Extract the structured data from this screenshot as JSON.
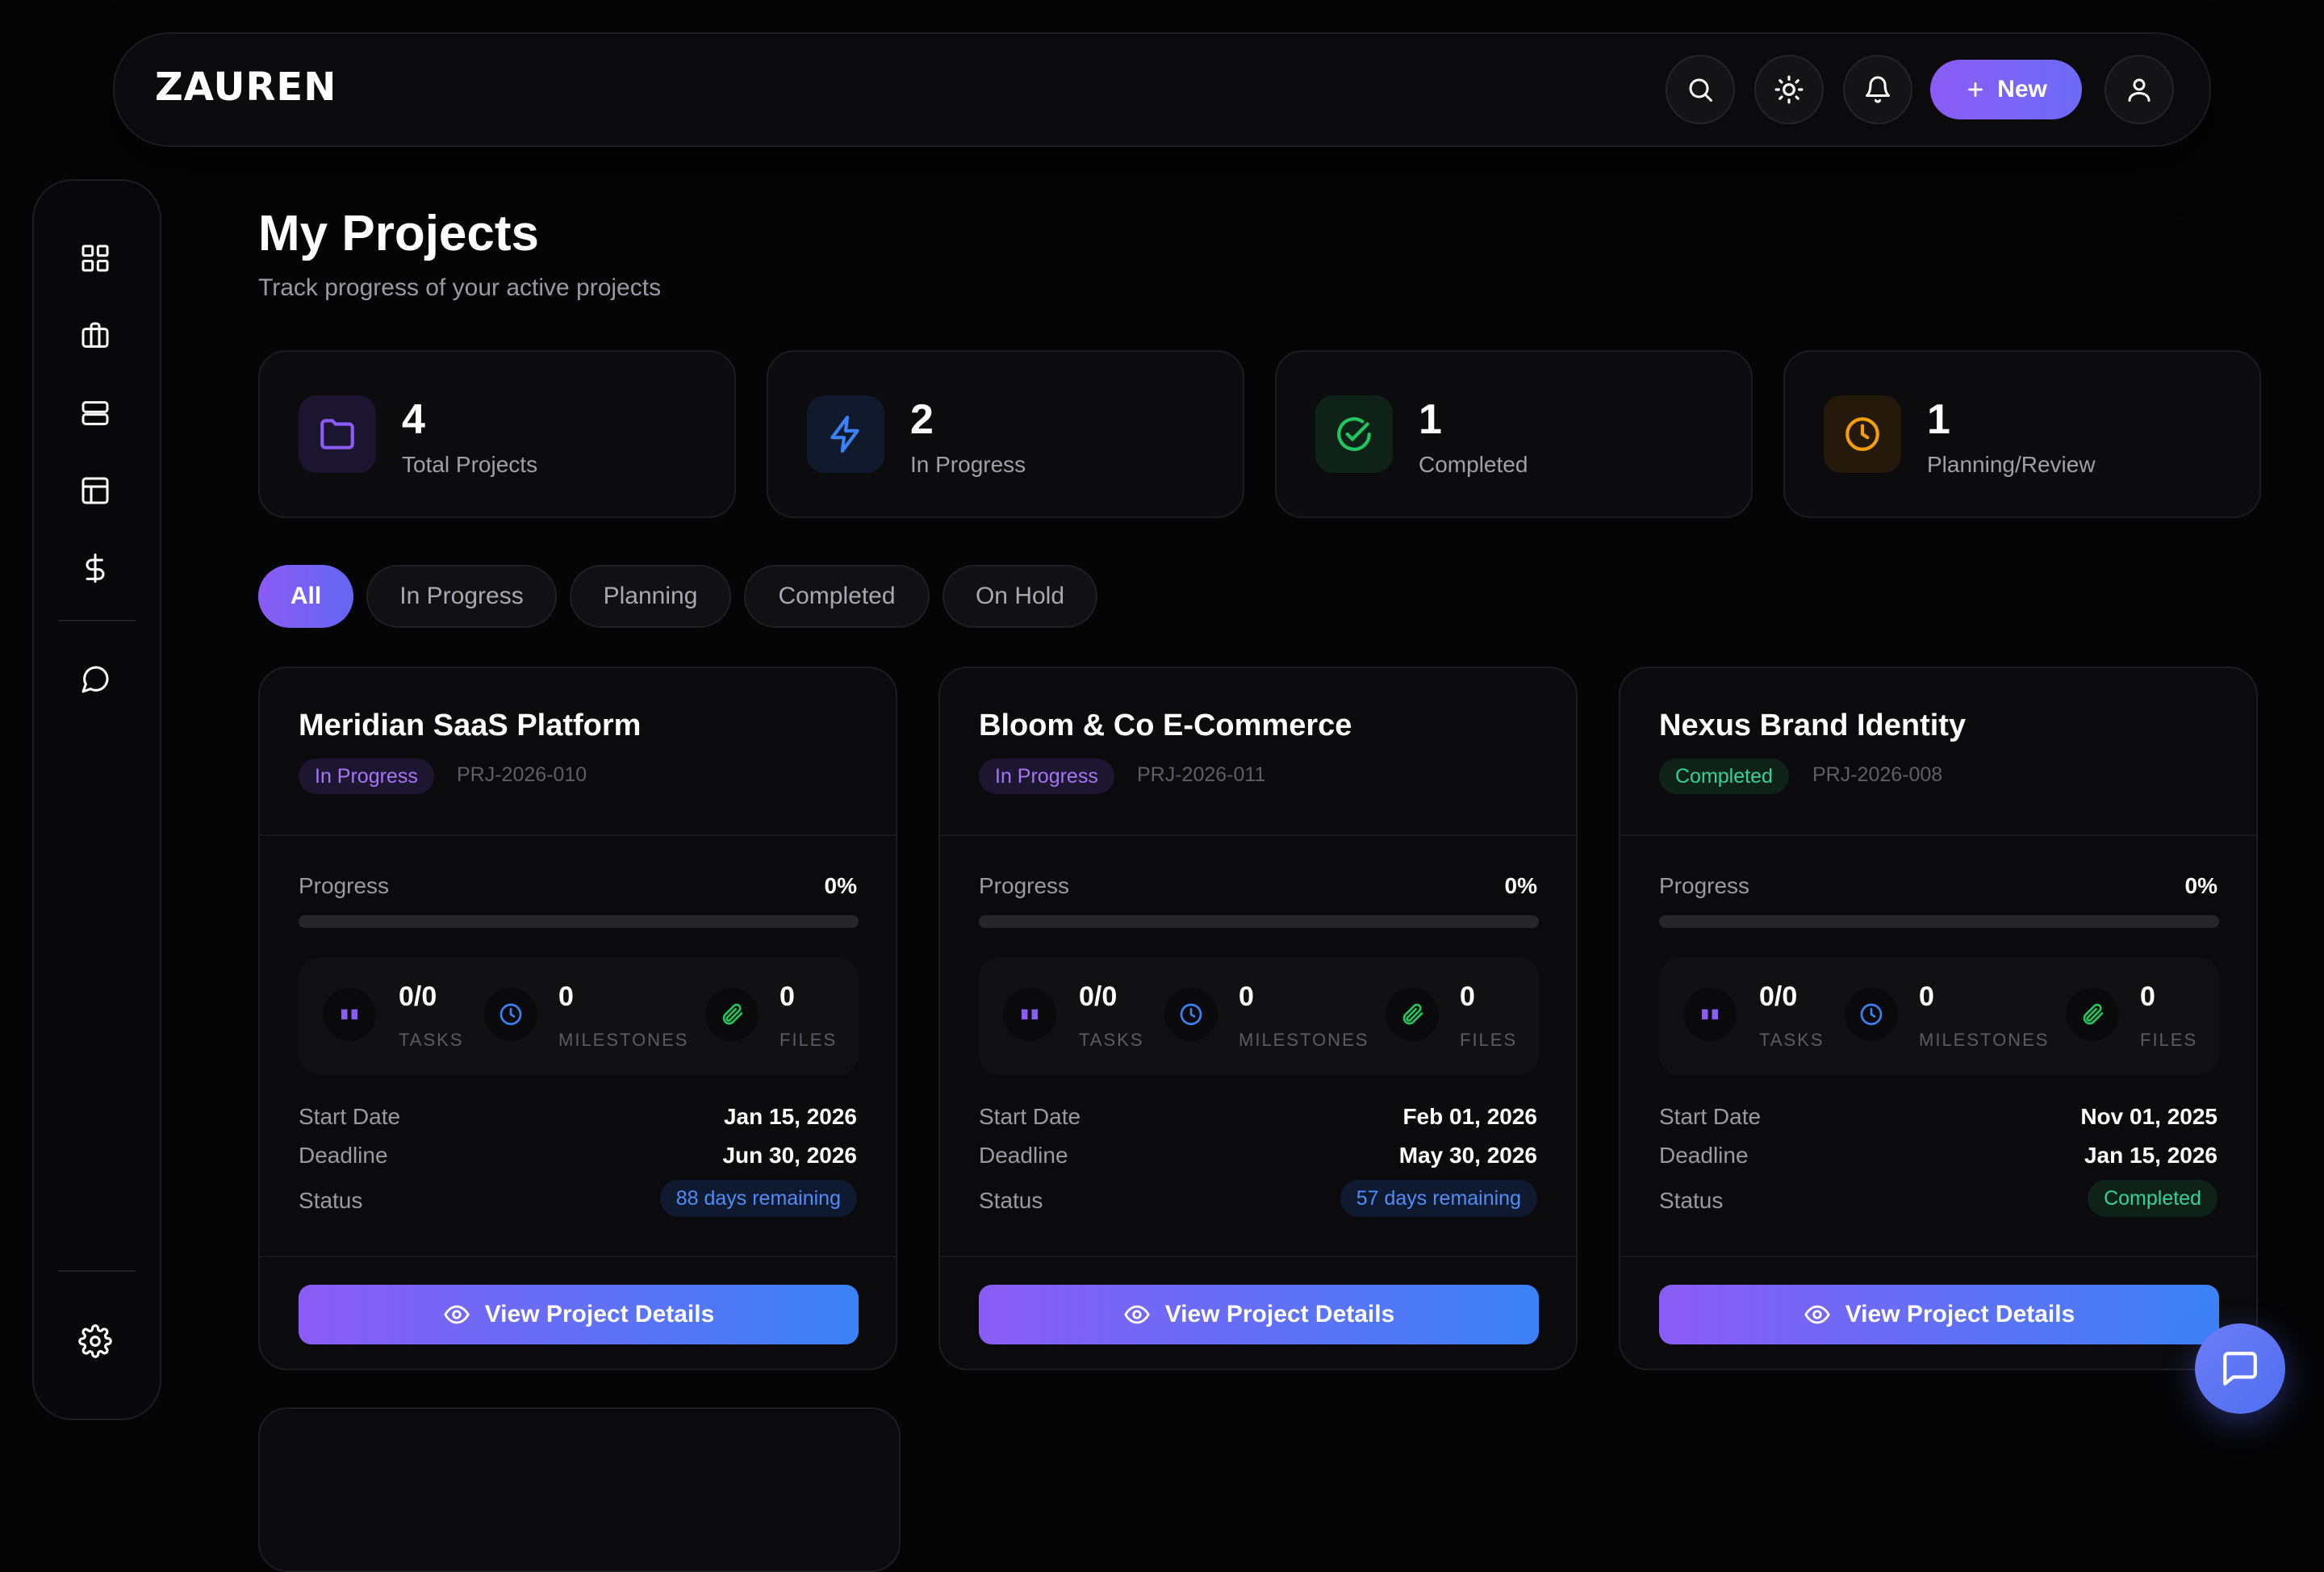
{
  "app": {
    "logo": "ZAUREN"
  },
  "topbar": {
    "new_label": "New"
  },
  "header": {
    "title": "My Projects",
    "subtitle": "Track progress of your active projects"
  },
  "stats": [
    {
      "value": "4",
      "label": "Total Projects",
      "icon": "folder-icon",
      "color": "#8b5cf6"
    },
    {
      "value": "2",
      "label": "In Progress",
      "icon": "lightning-icon",
      "color": "#3b82f6"
    },
    {
      "value": "1",
      "label": "Completed",
      "icon": "check-circle-icon",
      "color": "#22c55e"
    },
    {
      "value": "1",
      "label": "Planning/Review",
      "icon": "clock-icon",
      "color": "#f59e0b"
    }
  ],
  "filters": [
    "All",
    "In Progress",
    "Planning",
    "Completed",
    "On Hold"
  ],
  "active_filter": "All",
  "projects": [
    {
      "title": "Meridian SaaS Platform",
      "status": "In Progress",
      "code": "PRJ-2026-010",
      "progress_label": "Progress",
      "progress": "0%",
      "tasks": "0/0",
      "tasks_label": "TASKS",
      "milestones": "0",
      "milestones_label": "MILESTONES",
      "files": "0",
      "files_label": "FILES",
      "start_label": "Start Date",
      "start": "Jan 15, 2026",
      "deadline_label": "Deadline",
      "deadline": "Jun 30, 2026",
      "status_label": "Status",
      "status_value": "88 days remaining",
      "button": "View Project Details"
    },
    {
      "title": "Bloom & Co E-Commerce",
      "status": "In Progress",
      "code": "PRJ-2026-011",
      "progress_label": "Progress",
      "progress": "0%",
      "tasks": "0/0",
      "tasks_label": "TASKS",
      "milestones": "0",
      "milestones_label": "MILESTONES",
      "files": "0",
      "files_label": "FILES",
      "start_label": "Start Date",
      "start": "Feb 01, 2026",
      "deadline_label": "Deadline",
      "deadline": "May 30, 2026",
      "status_label": "Status",
      "status_value": "57 days remaining",
      "button": "View Project Details"
    },
    {
      "title": "Nexus Brand Identity",
      "status": "Completed",
      "code": "PRJ-2026-008",
      "progress_label": "Progress",
      "progress": "0%",
      "tasks": "0/0",
      "tasks_label": "TASKS",
      "milestones": "0",
      "milestones_label": "MILESTONES",
      "files": "0",
      "files_label": "FILES",
      "start_label": "Start Date",
      "start": "Nov 01, 2025",
      "deadline_label": "Deadline",
      "deadline": "Jan 15, 2026",
      "status_label": "Status",
      "status_value": "Completed",
      "button": "View Project Details"
    }
  ]
}
